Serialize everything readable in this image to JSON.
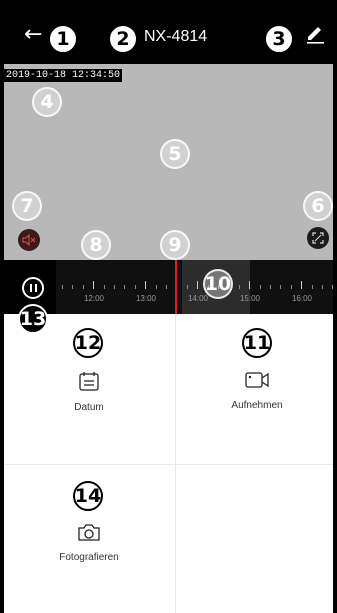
{
  "header": {
    "title": "NX-4814",
    "back_icon": "arrow-left-icon",
    "edit_icon": "pencil-icon"
  },
  "video": {
    "timestamp": "2019-10-18 12:34:50",
    "mute_icon": "speaker-muted-icon",
    "fullscreen_icon": "fullscreen-icon"
  },
  "timeline": {
    "pause_icon": "pause-icon",
    "tick_labels": [
      "12:00",
      "13:00",
      "14:00",
      "15:00",
      "16:00"
    ],
    "cursor_color": "#e02020"
  },
  "actions": {
    "date_label": "Datum",
    "record_label": "Aufnehmen",
    "photo_label": "Fotografieren"
  },
  "callouts": {
    "c1": "1",
    "c2": "2",
    "c3": "3",
    "c4": "4",
    "c5": "5",
    "c6": "6",
    "c7": "7",
    "c8": "8",
    "c9": "9",
    "c10": "10",
    "c11": "11",
    "c12": "12",
    "c13": "13",
    "c14": "14"
  }
}
